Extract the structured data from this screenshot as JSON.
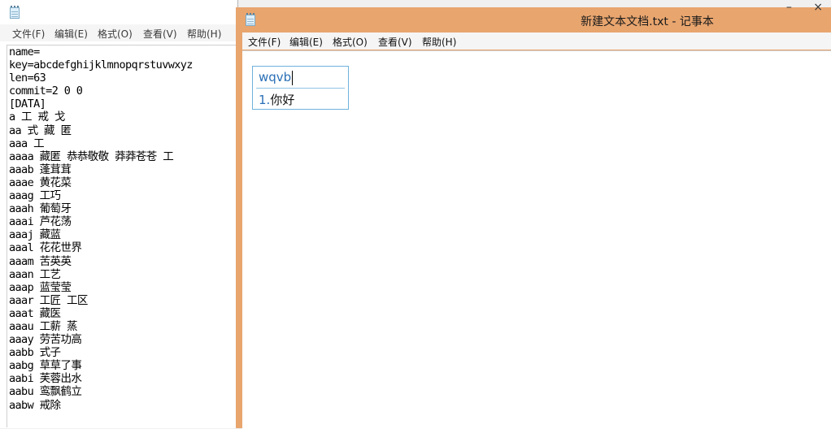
{
  "bg_window": {
    "menu": [
      "文件(F)",
      "编辑(E)",
      "格式(O)",
      "查看(V)",
      "帮助(H)"
    ],
    "lines": [
      "name=",
      "key=abcdefghijklmnopqrstuvwxyz",
      "len=63",
      "commit=2 0 0",
      "[DATA]",
      "a 工 戒 戈",
      "aa 式 藏 匿",
      "aaa 工",
      "aaaa 藏匿 恭恭敬敬 莽莽苍苍 工",
      "aaab 蓬茸茸",
      "aaae 黄花菜",
      "aaag 工巧",
      "aaah 葡萄牙",
      "aaai 芦花荡",
      "aaaj 藏蓝",
      "aaal 花花世界",
      "aaam 苦英英",
      "aaan 工艺",
      "aaap 蓝莹莹",
      "aaar 工匠 工区",
      "aaat 藏医",
      "aaau 工薪 蒸",
      "aaay 劳苦功高",
      "aabb 式子",
      "aabg 草草了事",
      "aabi 芙蓉出水",
      "aabu 鸾飘鹤立",
      "aabw 戒除"
    ]
  },
  "fg_window": {
    "title": "新建文本文档.txt - 记事本",
    "menu": [
      "文件(F)",
      "编辑(E)",
      "格式(O)",
      "查看(V)",
      "帮助(H)"
    ],
    "controls": {
      "minimize": "–",
      "close": "×"
    }
  },
  "ime": {
    "composition": "wqvb",
    "candidates": [
      {
        "index": "1.",
        "text": "你好"
      }
    ]
  }
}
